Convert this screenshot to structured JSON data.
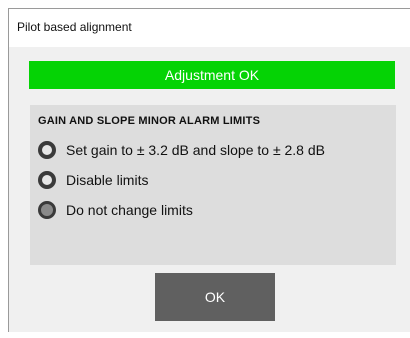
{
  "window": {
    "title": "Pilot based alignment"
  },
  "status": {
    "text": "Adjustment OK",
    "color": "#05d305"
  },
  "limits_group": {
    "title": "GAIN AND SLOPE MINOR ALARM LIMITS",
    "options": [
      {
        "label": "Set gain to ± 3.2 dB and slope to ± 2.8 dB",
        "selected": false
      },
      {
        "label": "Disable limits",
        "selected": false
      },
      {
        "label": "Do not change limits",
        "selected": true
      }
    ]
  },
  "buttons": {
    "ok_label": "OK"
  }
}
